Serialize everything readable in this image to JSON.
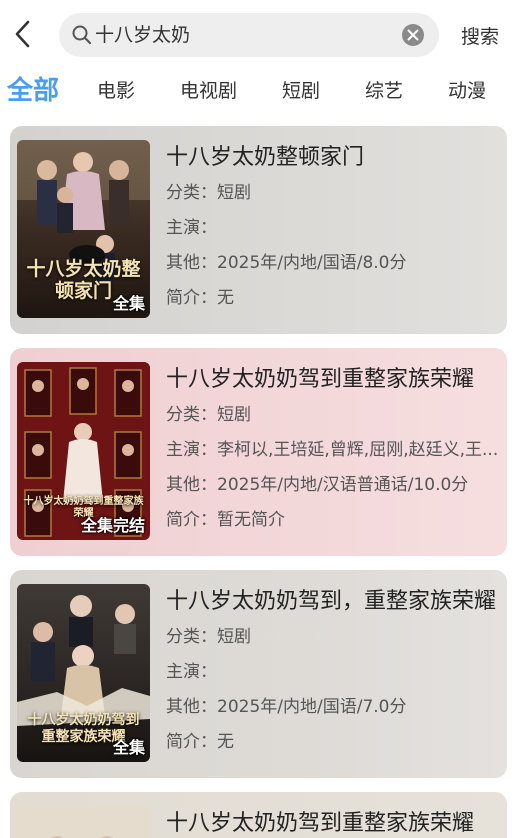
{
  "header": {
    "search_value": "十八岁太奶",
    "search_button": "搜索"
  },
  "tabs": [
    "全部",
    "电影",
    "电视剧",
    "短剧",
    "综艺",
    "动漫"
  ],
  "active_tab": "全部",
  "results": [
    {
      "title": "十八岁太奶整顿家门",
      "category_label": "分类：",
      "category": "短剧",
      "cast_label": "主演：",
      "cast": "",
      "other_label": "其他：",
      "other": "2025年/内地/国语/8.0分",
      "intro_label": "简介：",
      "intro": "无",
      "badge": "全集",
      "poster_text": "十八岁太奶整顿家门"
    },
    {
      "title": "十八岁太奶奶驾到重整家族荣耀",
      "category_label": "分类：",
      "category": "短剧",
      "cast_label": "主演：",
      "cast": "李柯以,王培延,曾辉,屈刚,赵廷义,王...",
      "other_label": "其他：",
      "other": "2025年/内地/汉语普通话/10.0分",
      "intro_label": "简介：",
      "intro": "暂无简介",
      "badge": "全集完结",
      "poster_text": "十八岁太奶奶驾到重整家族荣耀"
    },
    {
      "title": "十八岁太奶奶驾到，重整家族荣耀",
      "category_label": "分类：",
      "category": "短剧",
      "cast_label": "主演：",
      "cast": "",
      "other_label": "其他：",
      "other": "2025年/内地/国语/7.0分",
      "intro_label": "简介：",
      "intro": "无",
      "badge": "全集",
      "poster_text": "十八岁太奶奶驾到重整家族荣耀"
    },
    {
      "title": "十八岁太奶奶驾到重整家族荣耀"
    }
  ],
  "colors": {
    "accent": "#4a9df0",
    "card_pink": "#f3d8da",
    "card_gray": "#dcdad7"
  }
}
